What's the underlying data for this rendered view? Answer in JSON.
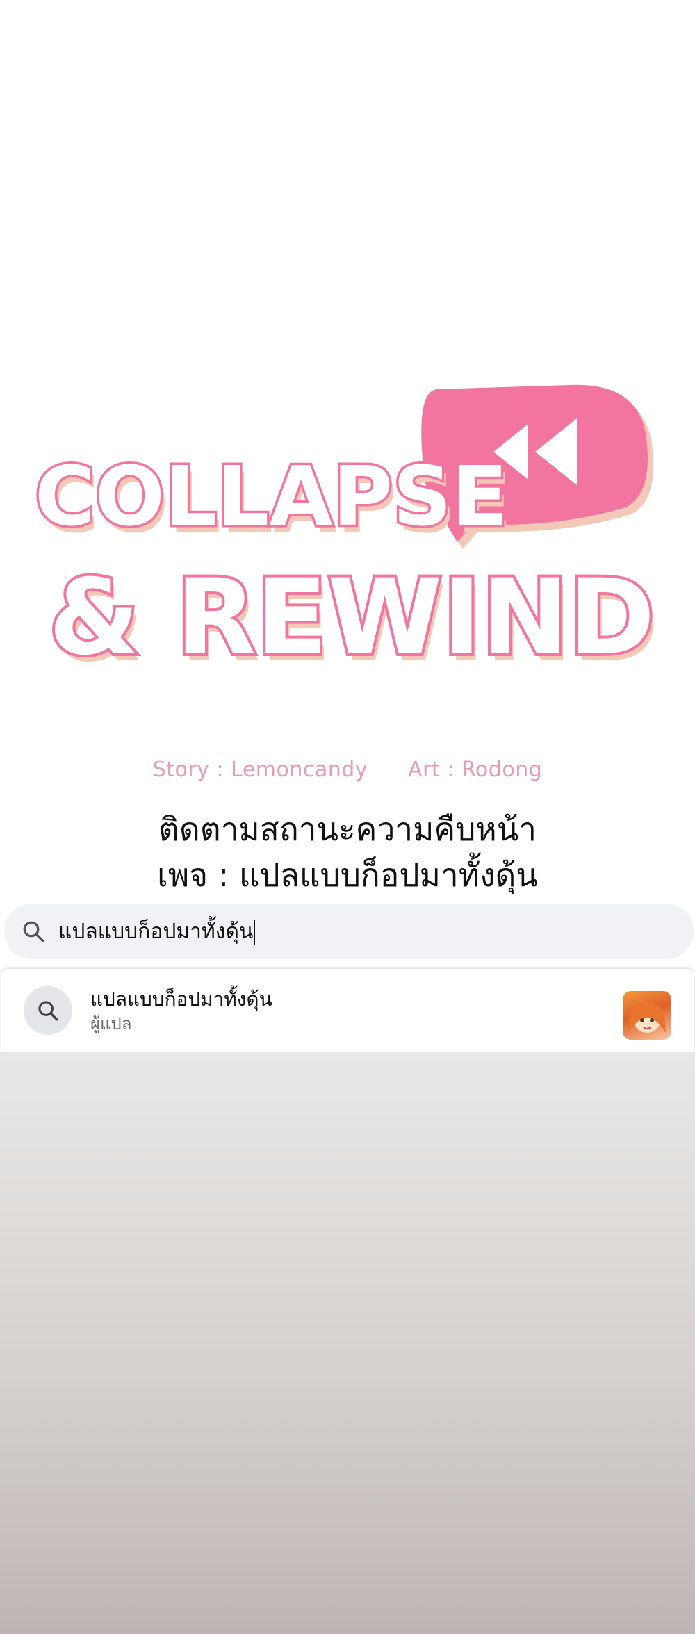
{
  "logo": {
    "line1": "COLLAPSE",
    "line2": "& REWIND",
    "accent_color": "#f2759f",
    "shadow_color": "#f4c8b6"
  },
  "credits": {
    "story": "Story : Lemoncandy",
    "art": "Art : Rodong"
  },
  "notice": {
    "line1": "ติดตามสถานะความคืบหน้า",
    "line2": "เพจ : แปลแบบก็อปมาทั้งดุ้น"
  },
  "search": {
    "value": "แปลแบบก็อปมาทั้งดุ้น",
    "icon": "search-icon"
  },
  "suggestion": {
    "title": "แปลแบบก็อปมาทั้งดุ้น",
    "subtitle": "ผู้แปล",
    "icon": "search-icon"
  }
}
